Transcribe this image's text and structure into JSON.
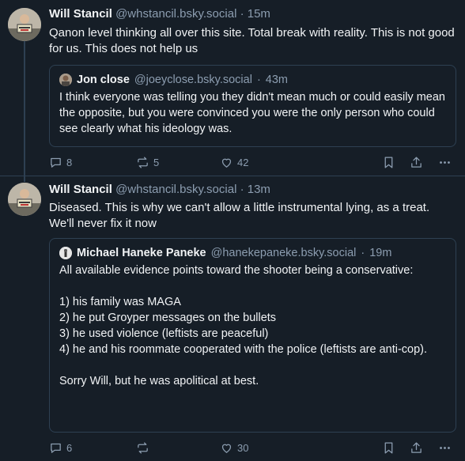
{
  "posts": [
    {
      "author": "Will Stancil",
      "handle": "@whstancil.bsky.social",
      "separator": "·",
      "time": "15m",
      "text": "Qanon level thinking all over this site. Total break with reality. This is not good for us. This does not help us",
      "quote": {
        "author": "Jon close",
        "handle": "@joeyclose.bsky.social",
        "separator": "·",
        "time": "43m",
        "text": "I think everyone was telling you they didn't mean much or could easily mean the opposite, but you were convinced you were the only person who could see clearly what his ideology was."
      },
      "replies": "8",
      "reposts": "5",
      "likes": "42"
    },
    {
      "author": "Will Stancil",
      "handle": "@whstancil.bsky.social",
      "separator": "·",
      "time": "13m",
      "text": "Diseased. This is why we can't allow a little instrumental lying, as a treat. We'll never fix it now",
      "quote": {
        "author": "Michael Haneke Paneke",
        "handle": "@hanekepaneke.bsky.social",
        "separator": "·",
        "time": "19m",
        "text": "All available evidence points toward the shooter being a conservative:\n\n1) his family was MAGA\n2) he put Groyper messages on the bullets\n3) he used violence (leftists are peaceful)\n4) he and his roommate cooperated with the police (leftists are anti-cop).\n\nSorry Will, but he was apolitical at best."
      },
      "replies": "6",
      "reposts": "",
      "likes": "30"
    }
  ],
  "icons": {
    "reply": "reply-icon",
    "repost": "repost-icon",
    "like": "heart-icon",
    "bookmark": "bookmark-icon",
    "share": "share-icon",
    "more": "more-icon"
  },
  "colors": {
    "background": "#161e27",
    "border": "#2e4052",
    "muted": "#8c9db0",
    "text": "#f1f3f5"
  }
}
